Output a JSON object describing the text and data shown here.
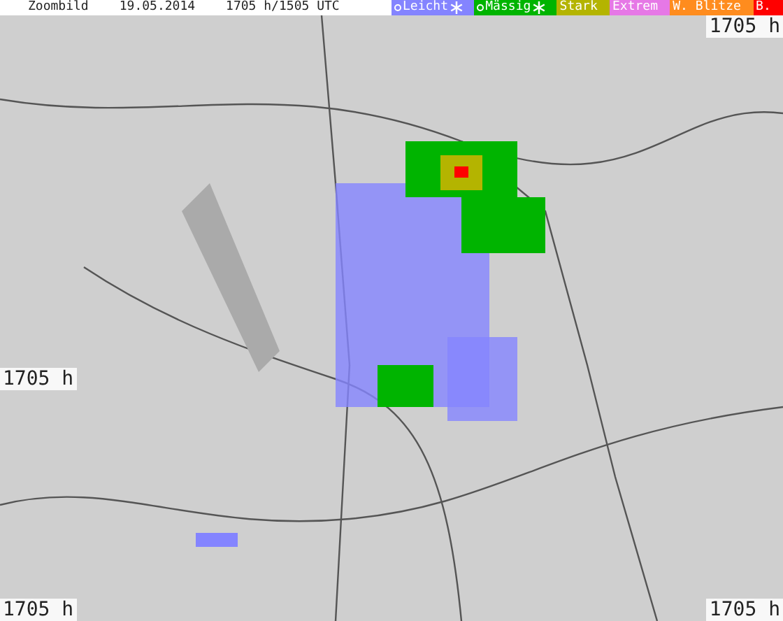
{
  "header": {
    "title": "Zoombild",
    "date": "19.05.2014",
    "time": "1705 h/1505 UTC"
  },
  "legend": [
    {
      "label": "Leicht",
      "color": "#8484ff",
      "symbols": true
    },
    {
      "label": "Mässig",
      "color": "#00b400",
      "symbols": true
    },
    {
      "label": "Stark",
      "color": "#b4b400",
      "symbols": false
    },
    {
      "label": "Extrem",
      "color": "#e678e6",
      "symbols": false
    },
    {
      "label": "W. Blitze",
      "color": "#ff8c1e",
      "symbols": false
    },
    {
      "label": "B.",
      "color": "#ff0000",
      "symbols": false
    }
  ],
  "timestamps": [
    {
      "kind": "top-right",
      "label": "1705 h"
    },
    {
      "kind": "middle-left",
      "label": "1705 h"
    },
    {
      "kind": "bottom-left",
      "label": "1705 h"
    },
    {
      "kind": "bottom-right",
      "label": "1705 h"
    }
  ]
}
